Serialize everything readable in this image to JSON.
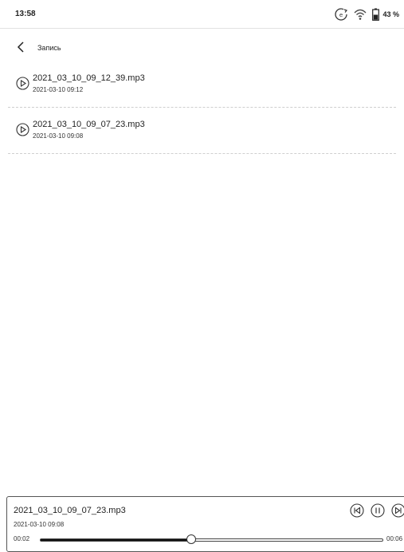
{
  "status_bar": {
    "time": "13:58",
    "battery": "43 %",
    "icons": [
      "sync-icon",
      "wifi-icon",
      "battery-icon"
    ]
  },
  "header": {
    "title": "Запись",
    "back_icon": "chevron-left-icon"
  },
  "recordings": [
    {
      "name": "2021_03_10_09_12_39.mp3",
      "date": "2021-03-10 09:12"
    },
    {
      "name": "2021_03_10_09_07_23.mp3",
      "date": "2021-03-10 09:08"
    }
  ],
  "player": {
    "name": "2021_03_10_09_07_23.mp3",
    "date": "2021-03-10 09:08",
    "time_start": "00:02",
    "time_end": "00:06",
    "progress": 0.44,
    "controls": [
      "previous-icon",
      "pause-icon",
      "next-icon"
    ]
  }
}
